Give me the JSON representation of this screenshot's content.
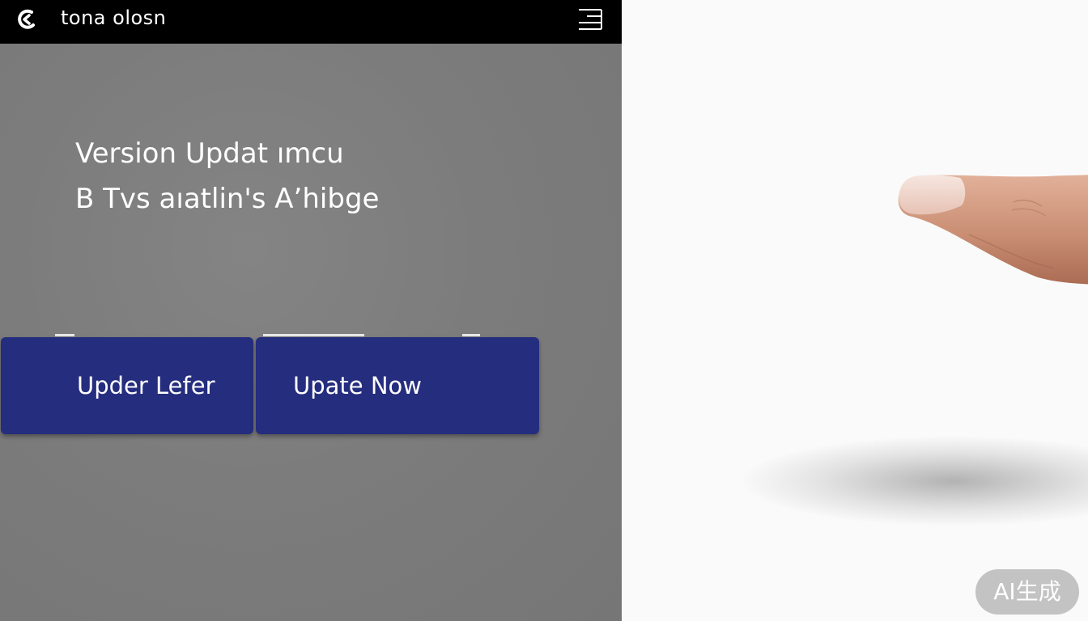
{
  "topbar": {
    "title": "tona olosn",
    "back_icon": "back-icon",
    "menu_icon": "menu-icon"
  },
  "dialog": {
    "heading": "Version Updat ımcu",
    "subheading": "B Tvs aıatlin's A’hibge"
  },
  "buttons": {
    "later_label": "Upder Lefer",
    "now_label": "Upate Now"
  },
  "colors": {
    "topbar": "#000000",
    "panel": "#7c7c7c",
    "button": "#252d7e",
    "text": "#ffffff"
  },
  "watermark": {
    "text": "AI生成"
  }
}
